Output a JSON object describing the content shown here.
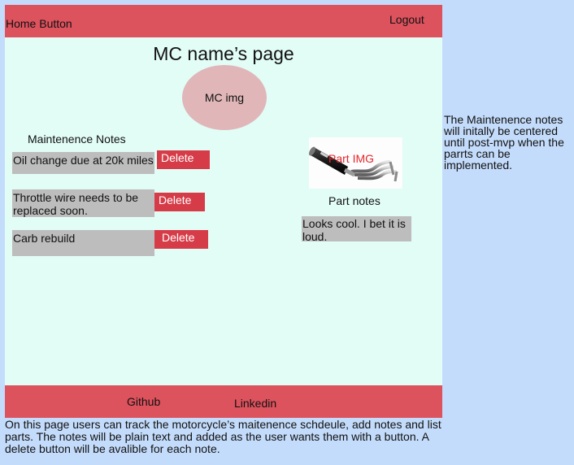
{
  "header": {
    "home_label": "Home Button",
    "logout_label": "Logout"
  },
  "page": {
    "title": "MC name’s page",
    "mc_image_label": "MC img"
  },
  "notes": {
    "title": "Maintenence Notes",
    "items": [
      {
        "text": "Oil change due at 20k miles",
        "delete_label": "Delete"
      },
      {
        "text": "Throttle wire needs to be replaced soon.",
        "delete_label": "Delete"
      },
      {
        "text": "Carb rebuild",
        "delete_label": "Delete"
      }
    ]
  },
  "part": {
    "image_label": "Part IMG",
    "notes_title": "Part notes",
    "note_text": "Looks cool. I bet it is loud."
  },
  "footer": {
    "github_label": "Github",
    "linkedin_label": "Linkedin"
  },
  "side_note": "The Maintenence notes will initally be centered until post-mvp when the parrts can be implemented.",
  "description": "On this page users can track the motorcycle’s maitenence schdeule, add notes and list parts. The notes will be plain text and added as the user wants them with a button. A delete button will be avalible for each note.",
  "colors": {
    "background": "#c4dcfb",
    "frame": "#e2fcf6",
    "bar": "#dc525d",
    "delete_button": "#d63c48",
    "note_box": "#bdbdbd",
    "mc_image": "#e0b6b8"
  },
  "icons": {
    "part_image": "exhaust-pipe-image"
  }
}
